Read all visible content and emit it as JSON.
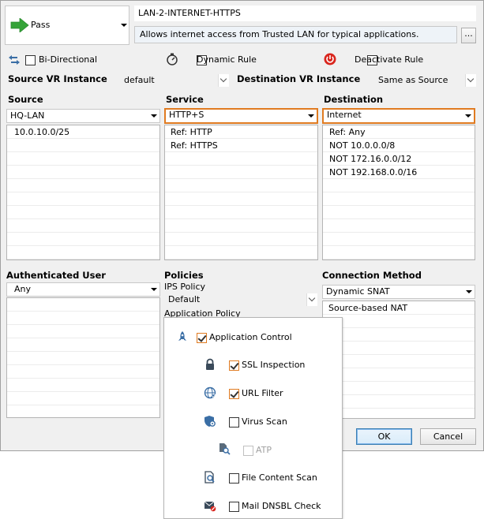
{
  "action": {
    "label": "Pass",
    "color": "#35a339"
  },
  "rule": {
    "name": "LAN-2-INTERNET-HTTPS",
    "description": "Allows internet access from Trusted LAN for typical applications.",
    "more_button": "..."
  },
  "options": {
    "bidirectional": "Bi-Directional",
    "dynamic_rule": "Dynamic Rule",
    "deactivate_rule": "Deactivate Rule"
  },
  "vr": {
    "source_label": "Source VR Instance",
    "source_value": "default",
    "destination_label": "Destination VR Instance",
    "destination_value": "Same as Source"
  },
  "source": {
    "label": "Source",
    "selected": "HQ-LAN",
    "items": [
      "10.0.10.0/25"
    ]
  },
  "service": {
    "label": "Service",
    "selected": "HTTP+S",
    "items": [
      "Ref: HTTP",
      "Ref: HTTPS"
    ]
  },
  "destination": {
    "label": "Destination",
    "selected": "Internet",
    "items": [
      "Ref: Any",
      "NOT 10.0.0.0/8",
      "NOT 172.16.0.0/12",
      "NOT 192.168.0.0/16"
    ]
  },
  "auth_user": {
    "label": "Authenticated User",
    "selected": "Any"
  },
  "policies": {
    "label": "Policies",
    "ips_label": "IPS Policy",
    "ips_value": "Default",
    "app_label": "Application Policy"
  },
  "connection": {
    "label": "Connection Method",
    "selected": "Dynamic SNAT",
    "items": [
      "Source-based NAT"
    ]
  },
  "app_policy_menu": [
    {
      "label": "Application Control",
      "checked": true,
      "icon": "rocket-icon"
    },
    {
      "label": "SSL Inspection",
      "checked": true,
      "icon": "lock-icon"
    },
    {
      "label": "URL Filter",
      "checked": true,
      "icon": "globe-filter-icon"
    },
    {
      "label": "Virus Scan",
      "checked": false,
      "icon": "shield-gear-icon"
    },
    {
      "label": "ATP",
      "checked": false,
      "icon": "document-search-icon",
      "disabled": true
    },
    {
      "label": "File Content Scan",
      "checked": false,
      "icon": "file-scan-icon"
    },
    {
      "label": "Mail DNSBL Check",
      "checked": false,
      "icon": "mail-block-icon"
    }
  ],
  "buttons": {
    "ok": "OK",
    "cancel": "Cancel"
  },
  "colors": {
    "highlight": "#e07b21",
    "accent_red": "#d9251d",
    "icon_blue": "#3a6ea5"
  }
}
